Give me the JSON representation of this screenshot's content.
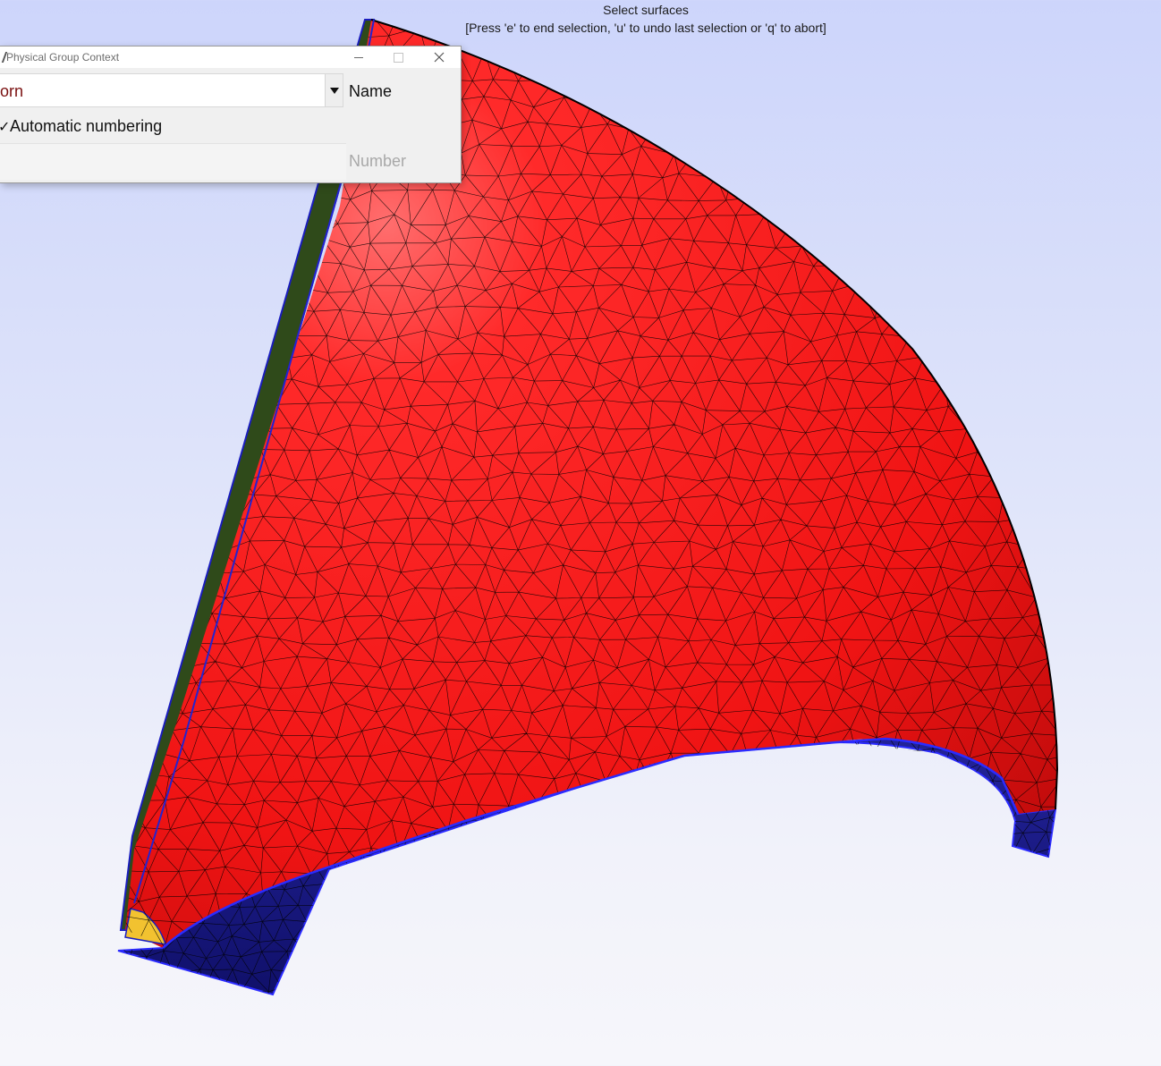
{
  "viewport": {
    "instruction_title": "Select surfaces",
    "instruction_detail": "[Press 'e' to end selection, 'u' to undo last selection or 'q' to abort]",
    "colors": {
      "outer_surface": "#ff1c1c",
      "edge_strip": "#1a1d88",
      "side_strip": "#2f4a1a",
      "small_face": "#f2c230",
      "mesh_lines": "#000000"
    }
  },
  "dialog": {
    "title": "Physical Group Context",
    "name_value": "orn",
    "name_label": "Name",
    "auto_number_label": "Automatic numbering",
    "auto_number_checked": true,
    "number_label": "Number",
    "number_value": "",
    "window_buttons": {
      "minimize": "minimize-icon",
      "maximize": "maximize-icon",
      "close": "close-icon"
    }
  }
}
